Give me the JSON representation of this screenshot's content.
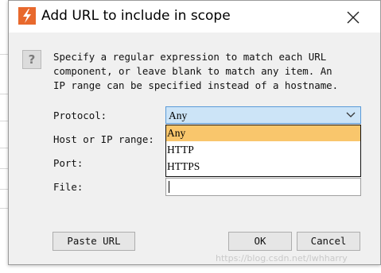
{
  "dialog": {
    "title": "Add URL to include in scope",
    "help_icon_glyph": "?",
    "description_lines": [
      "Specify a regular expression to match each URL",
      "component, or leave blank to match any item. An",
      "IP range can be specified instead of a hostname."
    ],
    "fields": {
      "protocol_label": "Protocol:",
      "host_label": "Host or IP range:",
      "port_label": "Port:",
      "file_label": "File:",
      "protocol_value": "Any",
      "file_value": ""
    },
    "protocol_options": [
      "Any",
      "HTTP",
      "HTTPS"
    ],
    "buttons": {
      "paste_url": "Paste URL",
      "ok": "OK",
      "cancel": "Cancel"
    },
    "watermark": "https://blog.csdn.net/lwhharry"
  },
  "colors": {
    "selected_option": "#f9c66c",
    "select_focus": "#cce4f7",
    "logo_orange": "#e8692d"
  },
  "icons": [
    "app-logo-icon",
    "close-icon",
    "help-icon",
    "chevron-down-icon"
  ]
}
